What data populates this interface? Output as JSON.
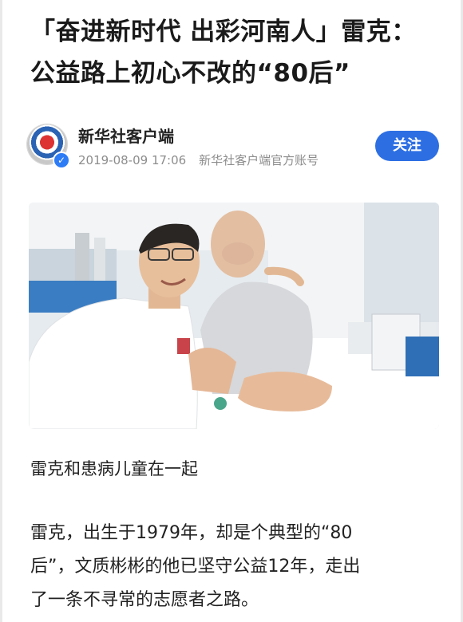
{
  "article": {
    "title_lines": [
      "「奋进新时代 出彩河南人」雷克：",
      "公益路上初心不改的“80后”"
    ]
  },
  "author": {
    "name": "新华社客户端",
    "datetime": "2019-08-09 17:06",
    "description": "新华社客户端官方账号",
    "follow_label": "关注",
    "avatar_icon": "xinhua-logo-icon",
    "verified_icon": "verified-check-icon",
    "verified_glyph": "✓"
  },
  "photo": {
    "caption": "雷克和患病儿童在一起"
  },
  "body": {
    "lines": [
      "雷克，出生于1979年，却是个典型的“80",
      "后”，文质彬彬的他已坚守公益12年，走出",
      "了一条不寻常的志愿者之路。"
    ]
  },
  "colors": {
    "follow_button": "#2d6fe3",
    "meta_text": "#8d8d8d",
    "title_text": "#1a1a1a"
  }
}
